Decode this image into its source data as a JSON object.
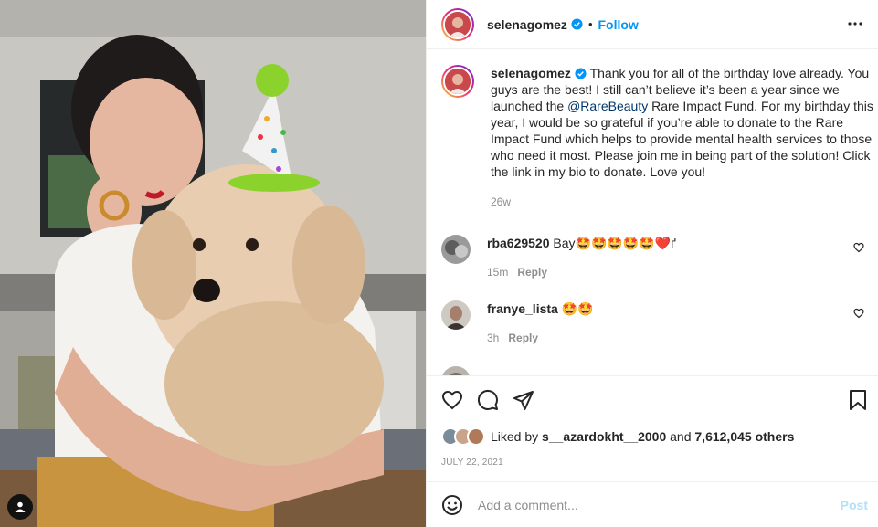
{
  "post": {
    "username": "selenagomez",
    "follow_label": "Follow",
    "dot": "•",
    "caption_before": "Thank you for all of the birthday love already. You guys are the best! I still can’t believe it’s been a year since we launched the ",
    "caption_mention": "@RareBeauty",
    "caption_after": " Rare Impact Fund. For my birthday this year, I would be so grateful if you’re able to donate to the Rare Impact Fund which helps to provide mental health services to those who need it most. Please join me in being part of the solution! Click the link in my bio to donate. Love you!",
    "caption_age": "26w"
  },
  "comments": [
    {
      "username": "rba629520",
      "text": "Bay🤩🤩🤩🤩🤩❤️ґ",
      "age": "15m",
      "reply_label": "Reply"
    },
    {
      "username": "franye_lista",
      "text": "🤩🤩",
      "age": "3h",
      "reply_label": "Reply"
    }
  ],
  "likes": {
    "prefix": "Liked by ",
    "user": "s__azardokht__2000",
    "middle": " and ",
    "count": "7,612,045 others"
  },
  "date": "JULY 22, 2021",
  "add_comment": {
    "placeholder": "Add a comment...",
    "post_label": "Post"
  },
  "icons": {
    "more": "more-options-icon",
    "like": "heart-icon",
    "comment": "comment-icon",
    "share": "share-icon",
    "save": "bookmark-icon",
    "emoji": "emoji-icon",
    "tag": "user-tag-icon"
  },
  "colors": {
    "follow": "#0095f6",
    "mention": "#00376b",
    "muted": "#8e8e8e",
    "post_disabled": "#b2dffc"
  }
}
